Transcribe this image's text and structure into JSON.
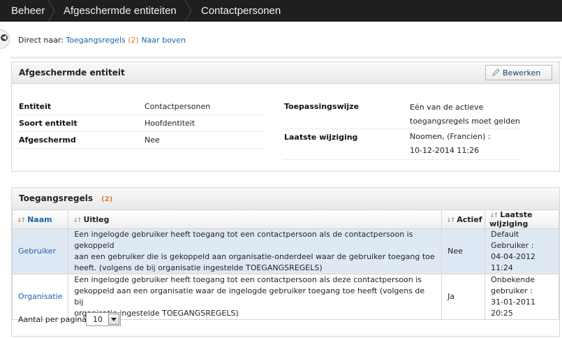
{
  "breadcrumb": [
    "Beheer",
    "Afgeschermde entiteiten",
    "Contactpersonen"
  ],
  "direct_nav": {
    "label": "Direct naar:",
    "link1": "Toegangsregels",
    "link1_count": "(2)",
    "link2": "Naar boven"
  },
  "entity_panel": {
    "title": "Afgeschermde entiteit",
    "edit_label": "Bewerken",
    "left_fields": [
      {
        "label": "Entiteit",
        "value": "Contactpersonen"
      },
      {
        "label": "Soort entiteit",
        "value": "Hoofdentiteit"
      },
      {
        "label": "Afgeschermd",
        "value": "Nee"
      }
    ],
    "right_fields": [
      {
        "label": "Toepassingswijze",
        "value_lines": [
          "Eén van de actieve",
          "toegangsregels moet gelden"
        ]
      },
      {
        "label": "Laatste wijziging",
        "value_lines": [
          "Noomen, (Francien) :",
          "10-12-2014 11:26"
        ]
      }
    ]
  },
  "rules_panel": {
    "title": "Toegangsregels",
    "count": "(2)",
    "columns": [
      "Naam",
      "Uitleg",
      "Actief",
      "Laatste wijziging"
    ],
    "rows": [
      {
        "name": "Gebruiker",
        "explanation": [
          "Een ingelogde gebruiker heeft toegang tot een contactpersoon als de contactpersoon is gekoppeld",
          "aan een gebruiker die is gekoppeld aan organisatie-onderdeel waar de gebruiker toegang toe",
          "heeft. (volgens de bij organisatie ingestelde TOEGANGSREGELS)"
        ],
        "active": "Nee",
        "modified": [
          "Default Gebruiker :",
          "04-04-2012 11:24"
        ]
      },
      {
        "name": "Organisatie",
        "explanation": [
          "Een ingelogde gebruiker heeft toegang tot een contactpersoon als deze contactpersoon is",
          "gekoppeld aan een organisatie waar de ingelogde gebruiker toegang toe heeft (volgens de bij",
          "organisatie ingestelde TOEGANGSREGELS)"
        ],
        "active": "Ja",
        "modified": [
          "Onbekende",
          "gebruiker :",
          "31-01-2011 20:25"
        ]
      }
    ],
    "per_page_label": "Aantal per pagina:",
    "per_page_value": "10"
  },
  "colors": {
    "topbar": "#1f1f1f",
    "link": "#1b63ad",
    "accent": "#e0772c",
    "selected_row": "#dfe9f5"
  }
}
